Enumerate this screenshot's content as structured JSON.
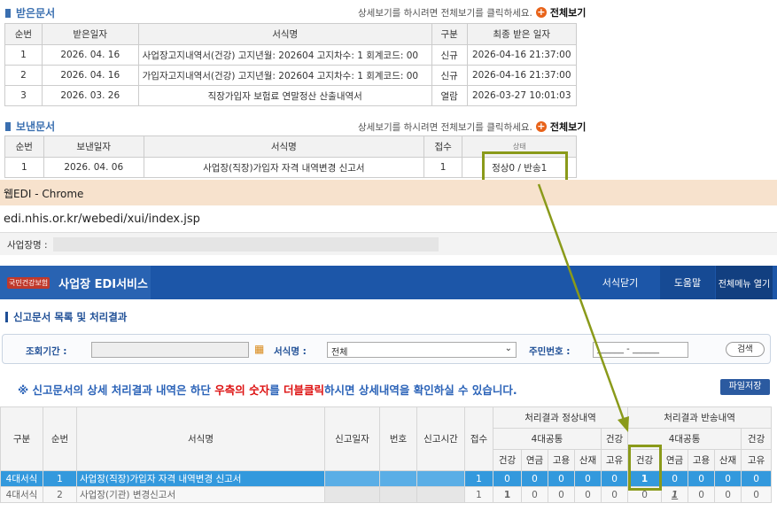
{
  "received": {
    "title": "받은문서",
    "hint": "상세보기를 하시려면 전체보기를 클릭하세요.",
    "view_all": "전체보기",
    "columns": [
      "순번",
      "받은일자",
      "서식명",
      "구분",
      "최종 받은 일자"
    ],
    "rows": [
      [
        "1",
        "2026. 04. 16",
        "사업장고지내역서(건강) 고지년월: 202604 고지차수: 1 회계코드: 00",
        "신규",
        "2026-04-16 21:37:00"
      ],
      [
        "2",
        "2026. 04. 16",
        "가입자고지내역서(건강) 고지년월: 202604 고지차수: 1 회계코드: 00",
        "신규",
        "2026-04-16 21:37:00"
      ],
      [
        "3",
        "2026. 03. 26",
        "직장가입자 보험료 연말정산 산출내역서",
        "열람",
        "2026-03-27 10:01:03"
      ]
    ]
  },
  "sent": {
    "title": "보낸문서",
    "hint": "상세보기를 하시려면 전체보기를 클릭하세요.",
    "view_all": "전체보기",
    "columns": [
      "순번",
      "보낸일자",
      "서식명",
      "접수",
      "상태"
    ],
    "rows": [
      [
        "1",
        "2026. 04. 06",
        "사업장(직장)가입자 자격 내역변경 신고서",
        "1",
        "정상0 / 반송1"
      ]
    ]
  },
  "window": {
    "title": "웹EDI - Chrome",
    "url": "edi.nhis.or.kr/webedi/xui/index.jsp",
    "biz_label": "사업장명 :"
  },
  "header": {
    "logo_text": "국민건강보험",
    "title": "사업장 EDI서비스",
    "close_form": "서식닫기",
    "help": "도움말",
    "open_menu": "전체메뉴 열기"
  },
  "page": {
    "title": "신고문서 목록 및 처리결과",
    "period_label": "조회기간 :",
    "form_label": "서식명 :",
    "form_value": "전체",
    "rrn_label": "주민번호 :",
    "rrn_placeholder": "______ - ______",
    "search_button": "검색",
    "notice_1": "※ 신고문서의 상세 처리결과 내역은 하단 ",
    "notice_2": "우측의 숫자",
    "notice_3": "를 ",
    "notice_4": "더블클릭",
    "notice_5": "하시면 상세내역을 확인하실 수 있습니다.",
    "file_save": "파일저장"
  },
  "results": {
    "h_type": "구분",
    "h_seq": "순번",
    "h_form": "서식명",
    "h_date": "신고일자",
    "h_no": "번호",
    "h_time": "신고시간",
    "h_recv": "접수",
    "h_normal": "처리결과 정상내역",
    "h_return": "처리결과 반송내역",
    "h_4ins": "4대공통",
    "h_health": "건강",
    "sub": [
      "건강",
      "연금",
      "고용",
      "산재",
      "고유",
      "건강",
      "연금",
      "고용",
      "산재",
      "고유"
    ],
    "rows": [
      {
        "type": "4대서식",
        "seq": "1",
        "form": "사업장(직장)가입자 자격 내역변경 신고서",
        "recv": "1",
        "vals": [
          "0",
          "0",
          "0",
          "0",
          "0",
          "1",
          "0",
          "0",
          "0",
          "0"
        ]
      },
      {
        "type": "4대서식",
        "seq": "2",
        "form": "사업장(기관) 변경신고서",
        "recv": "1",
        "vals": [
          "1",
          "0",
          "0",
          "0",
          "0",
          "0",
          "1",
          "0",
          "0",
          "0"
        ]
      }
    ]
  },
  "colors": {
    "header_blue": "#1c56a8",
    "selected_row": "#3399dd",
    "highlight": "#8a9a1a",
    "accent_orange": "#e8631a"
  }
}
